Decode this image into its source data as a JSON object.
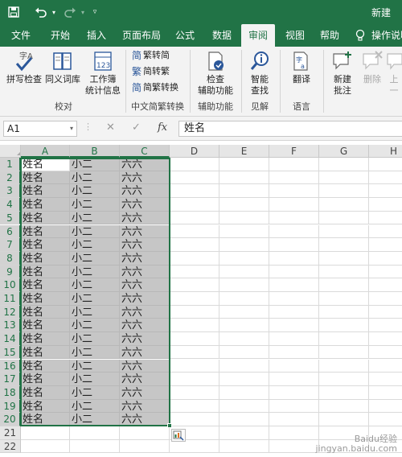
{
  "title_bar": {
    "save_icon": "save-icon",
    "undo_icon": "undo-icon",
    "redo_icon": "redo-icon",
    "customize_icon": "customize-qat-icon",
    "window_title": "新建"
  },
  "tabs": [
    "文件",
    "开始",
    "插入",
    "页面布局",
    "公式",
    "数据",
    "审阅",
    "视图",
    "帮助",
    "操作说明"
  ],
  "active_tab": "审阅",
  "tell_me_icon": "lightbulb-icon",
  "ribbon": {
    "spelling": "拼写检查",
    "thesaurus": "同义词库",
    "workbook_stats_line1": "工作簿",
    "workbook_stats_line2": "统计信息",
    "group_proofing": "校对",
    "trad_to_simp": "繁转简",
    "simp_to_trad": "简转繁",
    "conversion": "简繁转换",
    "group_chinese": "中文简繁转换",
    "check_access_line1": "检查",
    "check_access_line2": "辅助功能",
    "group_accessibility": "辅助功能",
    "smart_lookup_line1": "智能",
    "smart_lookup_line2": "查找",
    "group_insights": "见解",
    "translate": "翻译",
    "group_language": "语言",
    "new_comment_line1": "新建",
    "new_comment_line2": "批注",
    "delete_comment": "删除",
    "previous_comment": "上一"
  },
  "formula_bar": {
    "name_box": "A1",
    "cancel_symbol": "✕",
    "enter_symbol": "✓",
    "fx_symbol": "fx",
    "content": "姓名"
  },
  "columns": [
    "A",
    "B",
    "C",
    "D",
    "E",
    "F",
    "G",
    "H"
  ],
  "rows": [
    {
      "n": "1",
      "a": "姓名",
      "b": "小二",
      "c": "六六"
    },
    {
      "n": "2",
      "a": "姓名",
      "b": "小二",
      "c": "六六"
    },
    {
      "n": "3",
      "a": "姓名",
      "b": "小二",
      "c": "六六"
    },
    {
      "n": "4",
      "a": "姓名",
      "b": "小二",
      "c": "六六"
    },
    {
      "n": "5",
      "a": "姓名",
      "b": "小二",
      "c": "六六"
    },
    {
      "n": "6",
      "a": "姓名",
      "b": "小二",
      "c": "六六"
    },
    {
      "n": "7",
      "a": "姓名",
      "b": "小二",
      "c": "六六"
    },
    {
      "n": "8",
      "a": "姓名",
      "b": "小二",
      "c": "六六"
    },
    {
      "n": "9",
      "a": "姓名",
      "b": "小二",
      "c": "六六"
    },
    {
      "n": "10",
      "a": "姓名",
      "b": "小二",
      "c": "六六"
    },
    {
      "n": "11",
      "a": "姓名",
      "b": "小二",
      "c": "六六"
    },
    {
      "n": "12",
      "a": "姓名",
      "b": "小二",
      "c": "六六"
    },
    {
      "n": "13",
      "a": "姓名",
      "b": "小二",
      "c": "六六"
    },
    {
      "n": "14",
      "a": "姓名",
      "b": "小二",
      "c": "六六"
    },
    {
      "n": "15",
      "a": "姓名",
      "b": "小二",
      "c": "六六"
    },
    {
      "n": "16",
      "a": "姓名",
      "b": "小二",
      "c": "六六"
    },
    {
      "n": "17",
      "a": "姓名",
      "b": "小二",
      "c": "六六"
    },
    {
      "n": "18",
      "a": "姓名",
      "b": "小二",
      "c": "六六"
    },
    {
      "n": "19",
      "a": "姓名",
      "b": "小二",
      "c": "六六"
    },
    {
      "n": "20",
      "a": "姓名",
      "b": "小二",
      "c": "六六"
    },
    {
      "n": "21",
      "a": "",
      "b": "",
      "c": ""
    },
    {
      "n": "22",
      "a": "",
      "b": "",
      "c": ""
    }
  ],
  "selected_range": "A1:C20",
  "quick_analysis_icon": "quick-analysis-icon",
  "watermark_line1": "Baidu经验",
  "watermark_line2": "jingyan.baidu.com",
  "colors": {
    "excel_green": "#217346",
    "selection_fill": "#c6c6c6",
    "ribbon_bg": "#f3f3f3"
  }
}
